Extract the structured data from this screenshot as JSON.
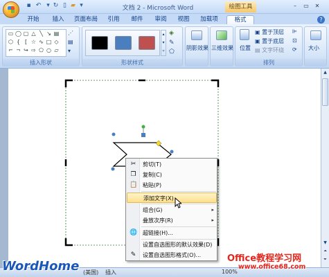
{
  "window": {
    "title": "文档 2 - Microsoft Word",
    "tool_context": "绘图工具"
  },
  "tabs": [
    {
      "label": "开始"
    },
    {
      "label": "插入"
    },
    {
      "label": "页面布局"
    },
    {
      "label": "引用"
    },
    {
      "label": "邮件"
    },
    {
      "label": "审阅"
    },
    {
      "label": "视图"
    },
    {
      "label": "加载项"
    },
    {
      "label": "格式"
    }
  ],
  "ribbon": {
    "insert_shapes": {
      "label": "插入形状"
    },
    "shape_styles": {
      "label": "形状样式",
      "swatches": [
        "#000000",
        "#4a7ebf",
        "#c0504d"
      ]
    },
    "shadow": {
      "label": "阴影效果"
    },
    "threed": {
      "label": "三维效果"
    },
    "position": {
      "label": "位置"
    },
    "arrange": {
      "label": "排列",
      "bring_front": "置于顶层",
      "send_back": "置于底层",
      "text_wrap": "文字环绕"
    },
    "size": {
      "label": "大小"
    }
  },
  "context_menu": {
    "items": [
      {
        "label": "剪切(T)",
        "icon": "scissors-icon"
      },
      {
        "label": "复制(C)",
        "icon": "copy-icon"
      },
      {
        "label": "粘贴(P)",
        "icon": "paste-icon"
      },
      {
        "label": "添加文字(X)"
      },
      {
        "label": "组合(G)",
        "submenu": "▸"
      },
      {
        "label": "叠放次序(R)",
        "submenu": "▸"
      },
      {
        "label": "超链接(H)...",
        "icon": "hyperlink-icon"
      },
      {
        "label": "设置自选图形的默认效果(D)"
      },
      {
        "label": "设置自选图形格式(O)...",
        "icon": "format-shape-icon"
      }
    ]
  },
  "statusbar": {
    "language": "(美国)",
    "mode": "插入",
    "zoom": "100%"
  },
  "watermark": {
    "left": "WordHome",
    "right_top": "Office教程学习网",
    "right_bottom": "www.office68.com"
  }
}
